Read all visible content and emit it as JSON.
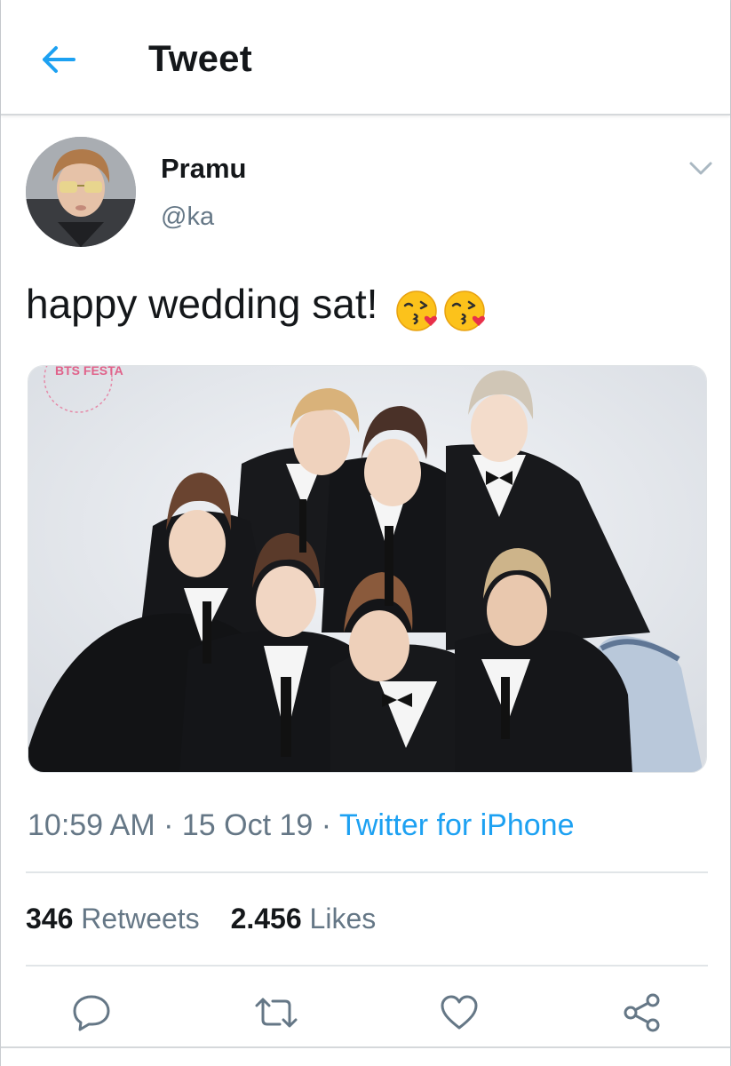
{
  "header": {
    "title": "Tweet",
    "back_icon": "back-arrow-icon",
    "accent_color": "#1da1f2"
  },
  "tweet": {
    "author": {
      "display_name": "Pramu",
      "handle": "@ka"
    },
    "text": "happy wedding sat!",
    "emojis": [
      "face-blowing-a-kiss",
      "face-blowing-a-kiss"
    ],
    "media": {
      "watermark": "BTS FESTA"
    },
    "time": "10:59 AM",
    "date": "15 Oct 19",
    "separator": "·",
    "source": "Twitter for iPhone"
  },
  "stats": {
    "retweets_count": "346",
    "retweets_label": "Retweets",
    "likes_count": "2.456",
    "likes_label": "Likes"
  },
  "actions": {
    "icons": [
      "reply-icon",
      "retweet-icon",
      "like-icon",
      "share-icon"
    ]
  }
}
